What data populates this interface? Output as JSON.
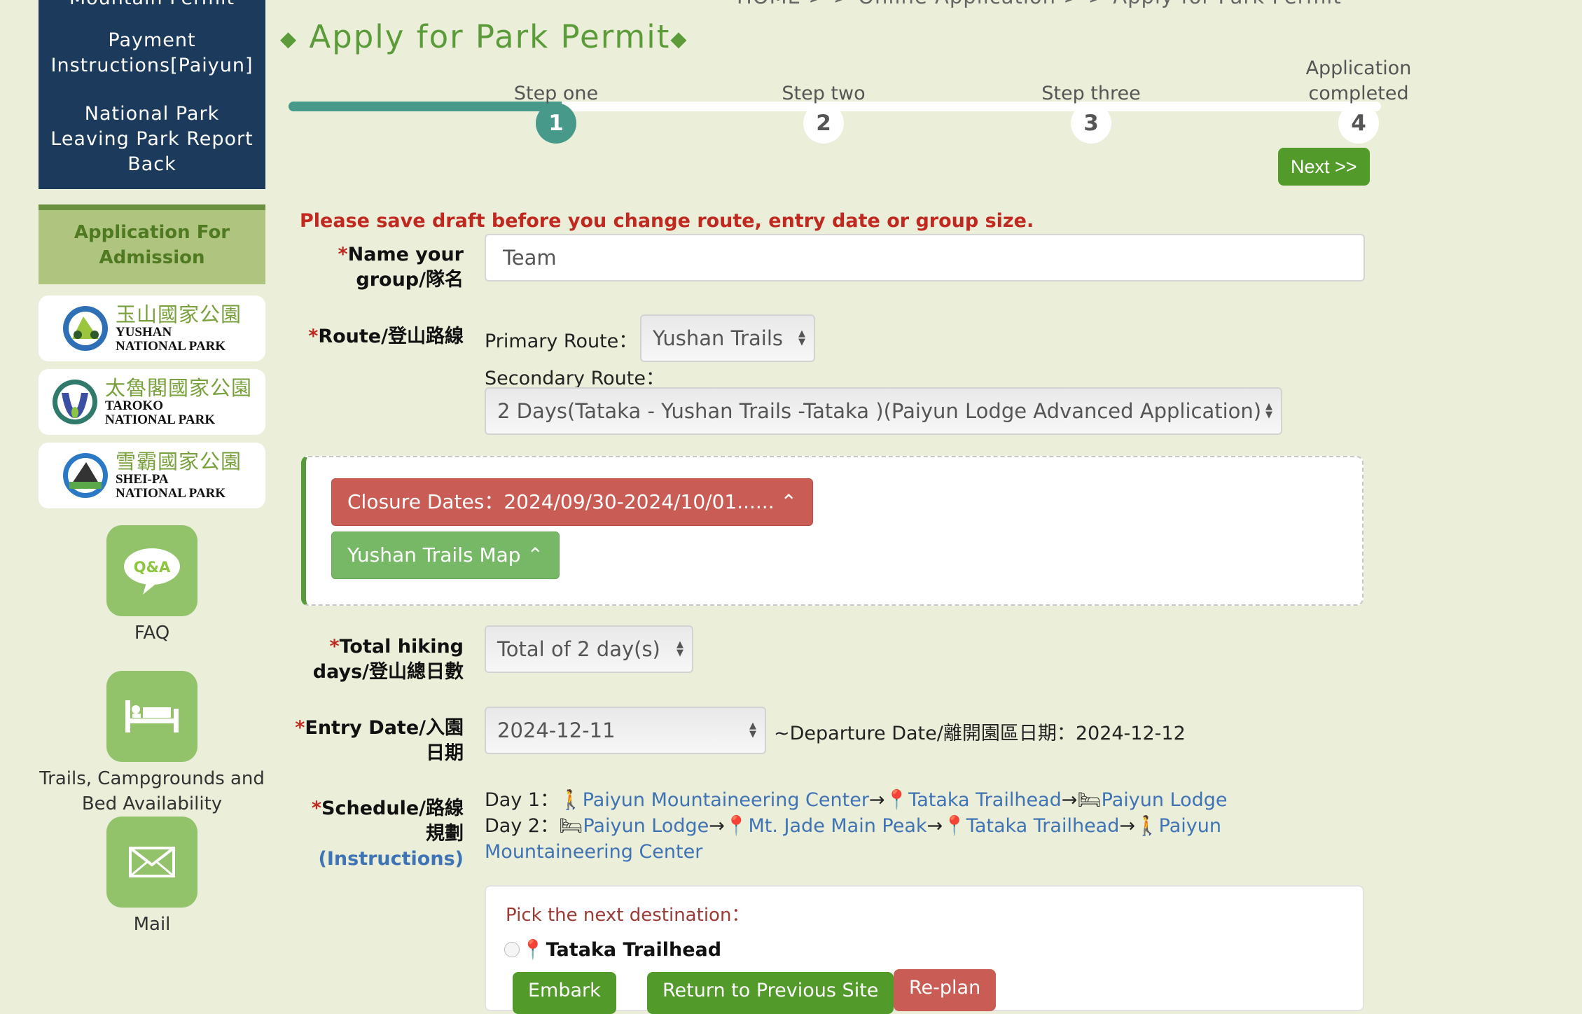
{
  "sidebar": {
    "nav_items": [
      "Mountain Permit",
      "Payment Instructions[Paiyun]",
      "National Park Leaving Park Report Back"
    ],
    "admission_label": "Application For Admission",
    "parks": [
      {
        "zh": "玉山國家公園",
        "en1": "YUSHAN",
        "en2": "NATIONAL PARK",
        "color": "#3a7fc1"
      },
      {
        "zh": "太魯閣國家公園",
        "en1": "TAROKO",
        "en2": "NATIONAL PARK",
        "color": "#3b4fa3"
      },
      {
        "zh": "雪霸國家公園",
        "en1": "SHEI-PA",
        "en2": "NATIONAL PARK",
        "color": "#2a78c6"
      }
    ],
    "links": [
      {
        "icon": "qa-icon",
        "icon_text": "Q&A",
        "label": "FAQ"
      },
      {
        "icon": "bed-icon",
        "label": "Trails, Campgrounds and Bed Availability"
      },
      {
        "icon": "mail-icon",
        "label": "Mail"
      }
    ]
  },
  "header": {
    "breadcrumb": "HOME > > Online Application > > Apply for Park Permit",
    "title": "Apply for Park Permit",
    "title_marker": "◆"
  },
  "steps": {
    "current": 1,
    "progress_percent": 25,
    "items": [
      {
        "num": "1",
        "label": "Step one"
      },
      {
        "num": "2",
        "label": "Step two"
      },
      {
        "num": "3",
        "label": "Step three"
      },
      {
        "num": "4",
        "label": "Application completed"
      }
    ],
    "next_label": "Next >>"
  },
  "form": {
    "warning": "Please save draft before you change route, entry date or group size.",
    "required_mark": "*",
    "group_name": {
      "label": "Name your group/隊名",
      "value": "Team"
    },
    "route": {
      "label": "Route/登山路線",
      "primary_label": "Primary Route：",
      "primary_value": "Yushan Trails",
      "secondary_label": "Secondary Route：",
      "secondary_value": "2 Days(Tataka - Yushan Trails -Tataka )(Paiyun Lodge Advanced Application)"
    },
    "closure_button": "Closure Dates：2024/09/30-2024/10/01......",
    "map_button": "Yushan Trails Map",
    "hiking_days": {
      "label": "Total hiking days/登山總日數",
      "value": "Total of 2 day(s)"
    },
    "entry_date": {
      "label": "Entry Date/入園日期",
      "value": "2024-12-11",
      "departure": "~Departure Date/離開園區日期：2024-12-12"
    },
    "schedule": {
      "label": "Schedule/路線規劃",
      "instructions": "(Instructions)",
      "days": [
        {
          "prefix": "Day 1：",
          "stops": [
            {
              "icon": "hiker",
              "name": "Paiyun Mountaineering Center"
            },
            {
              "icon": "pin",
              "name": "Tataka Trailhead"
            },
            {
              "icon": "bed",
              "name": "Paiyun Lodge"
            }
          ]
        },
        {
          "prefix": "Day 2：",
          "stops": [
            {
              "icon": "bed",
              "name": "Paiyun Lodge"
            },
            {
              "icon": "pin",
              "name": "Mt. Jade Main Peak"
            },
            {
              "icon": "pin",
              "name": "Tataka Trailhead"
            },
            {
              "icon": "hiker",
              "name": "Paiyun Mountaineering Center"
            }
          ]
        }
      ]
    },
    "picker": {
      "title": "Pick the next destination：",
      "option": "Tataka Trailhead",
      "buttons": [
        "Embark",
        "Return to Previous Site",
        "Re-plan"
      ]
    }
  },
  "colors": {
    "accent_green": "#529a2a",
    "step_teal": "#47998a",
    "danger": "#c95c54",
    "nav_blue": "#1b3a5c"
  }
}
